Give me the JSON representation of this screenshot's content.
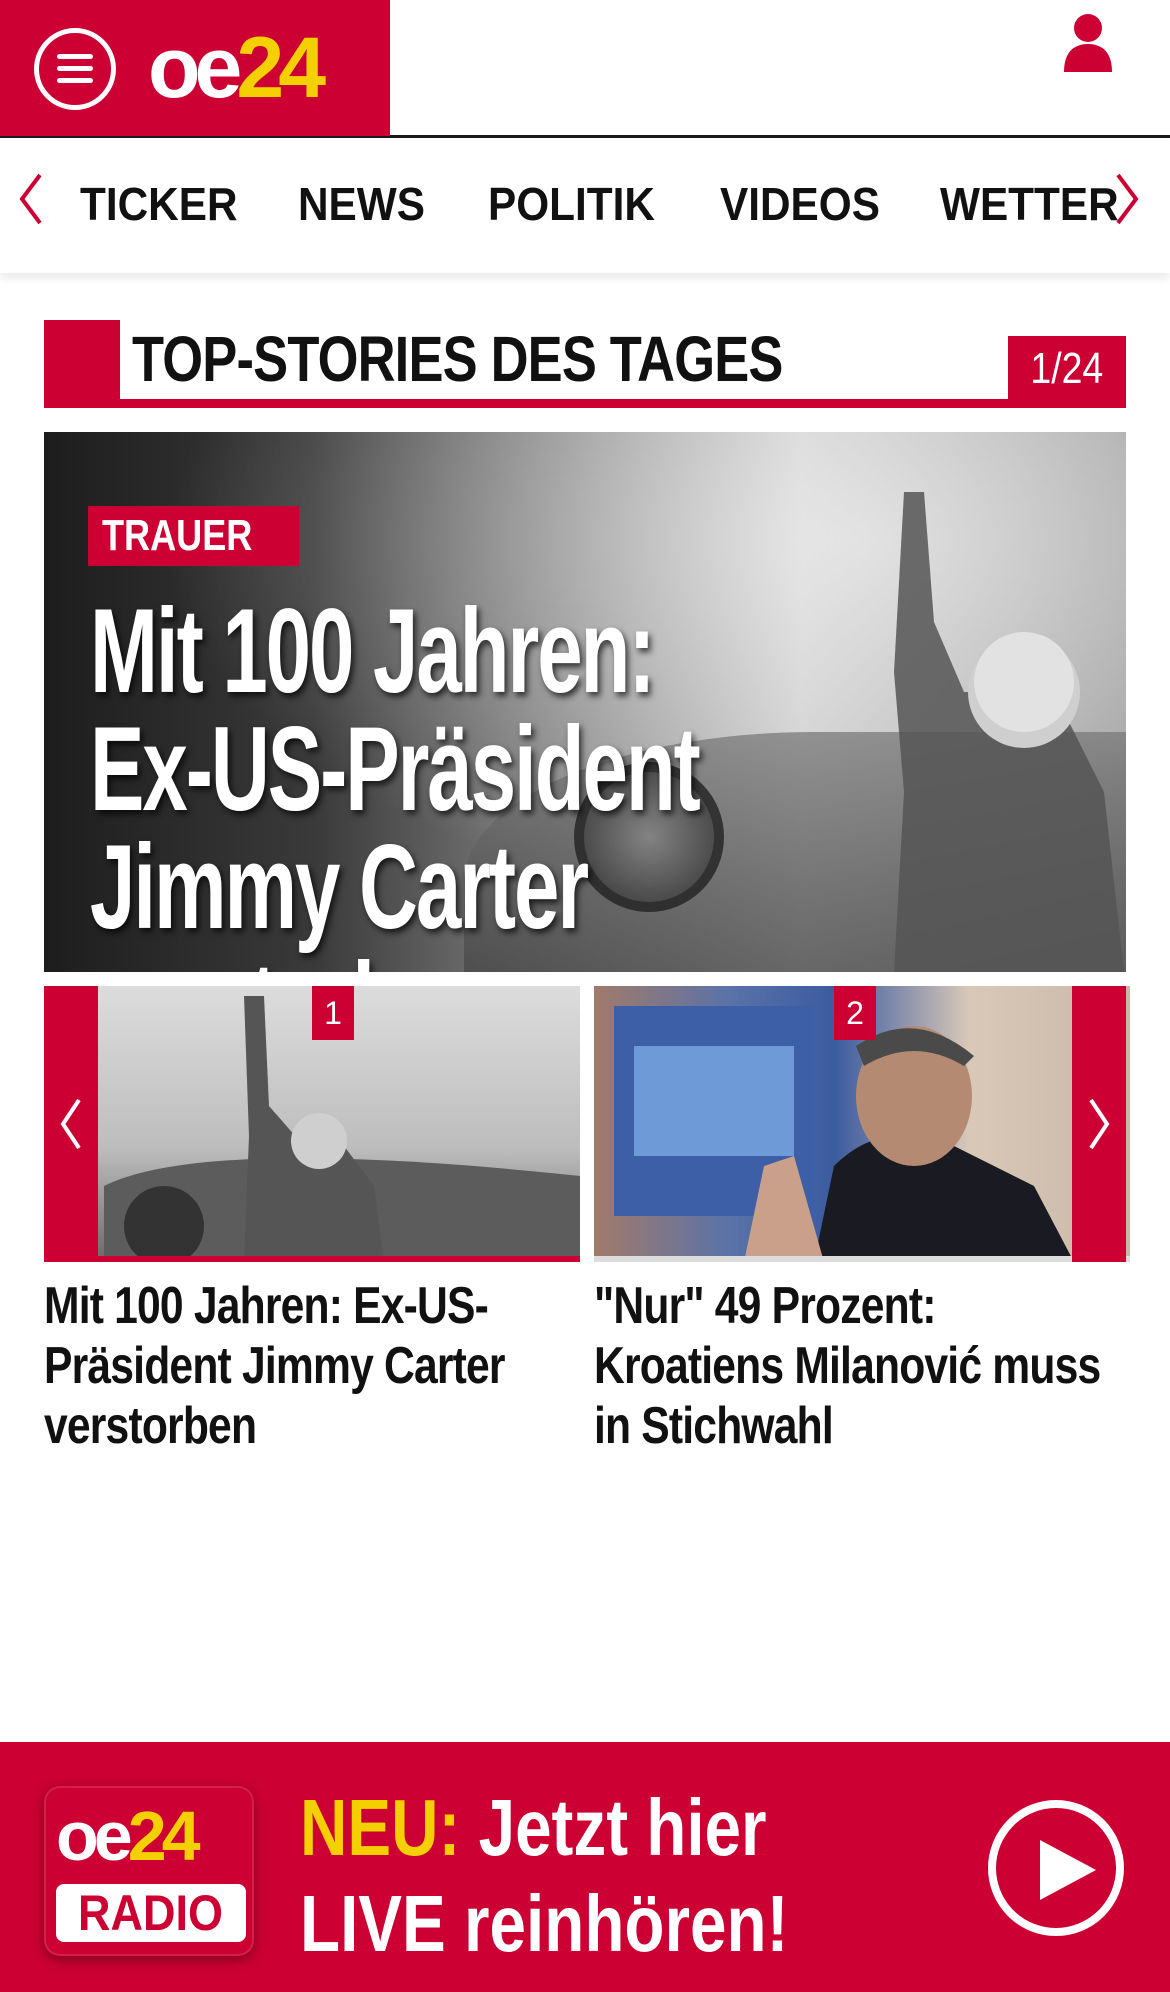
{
  "header": {
    "logo_oe": "oe",
    "logo_num": "24",
    "menu_icon": "hamburger-menu-icon",
    "user_icon": "user-icon"
  },
  "nav": {
    "items": [
      "TICKER",
      "NEWS",
      "POLITIK",
      "VIDEOS",
      "WETTER"
    ],
    "prev_icon": "chevron-left-icon",
    "next_icon": "chevron-right-icon"
  },
  "section": {
    "title": "TOP-STORIES DES TAGES",
    "counter": "1/24"
  },
  "hero": {
    "category": "TRAUER",
    "headline_lines": [
      "Mit 100 Jahren:",
      "Ex-US-Präsident",
      "Jimmy Carter verstorben"
    ]
  },
  "carousel": {
    "cards": [
      {
        "number": "1",
        "title": "Mit 100 Jahren: Ex-US-Präsident Jimmy Carter verstorben"
      },
      {
        "number": "2",
        "title": "\"Nur\" 49 Prozent: Kroatiens Milanović muss in Stichwahl"
      }
    ]
  },
  "radio": {
    "logo_oe": "oe",
    "logo_num": "24",
    "logo_label": "RADIO",
    "neu": "NEU:",
    "line1_rest": "Jetzt hier",
    "line2": "LIVE reinhören!",
    "play_icon": "play-icon"
  },
  "colors": {
    "brand_red": "#cc0033",
    "brand_yellow": "#f5d000"
  }
}
